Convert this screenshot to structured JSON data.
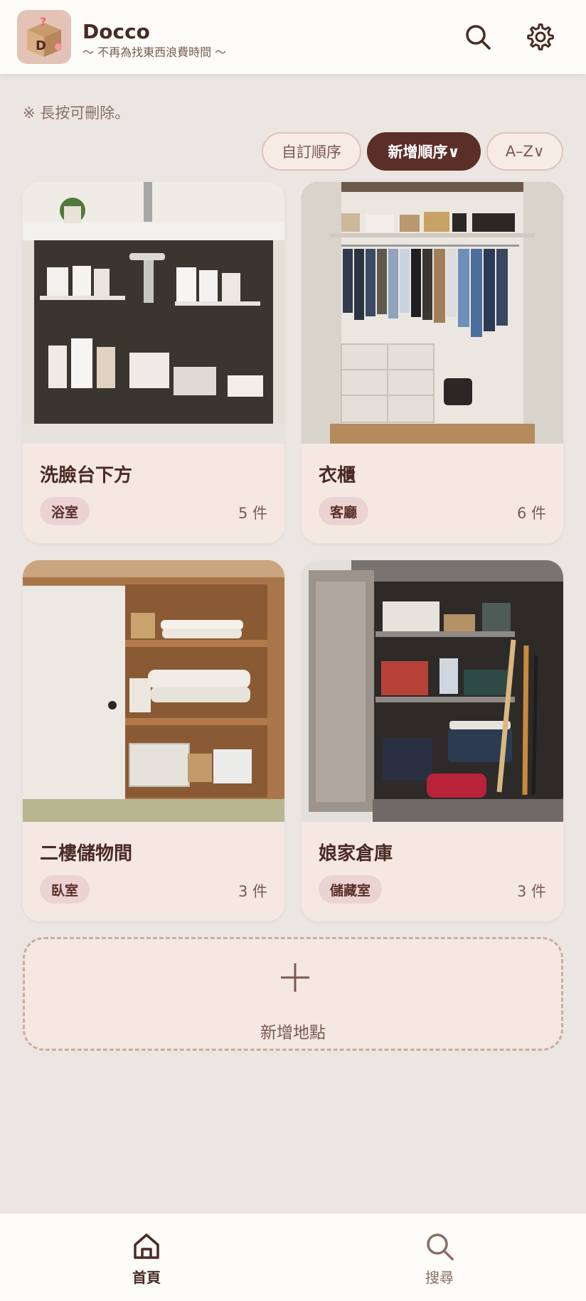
{
  "header": {
    "logo_letter": "D",
    "logo_mark": "?",
    "app_name": "Docco",
    "tagline": "～ 不再為找東西浪費時間 ～",
    "search_icon": "search-icon",
    "settings_icon": "gear-icon"
  },
  "hint": "※ 長按可刪除。",
  "sort": {
    "options": [
      {
        "label": "自訂順序",
        "active": false
      },
      {
        "label": "新增順序∨",
        "active": true
      },
      {
        "label": "A–Z∨",
        "active": false
      }
    ]
  },
  "locations": [
    {
      "name": "洗臉台下方",
      "room": "浴室",
      "count": "5 件",
      "photo": "under-sink cabinet with bottles and baskets"
    },
    {
      "name": "衣櫃",
      "room": "客廳",
      "count": "6 件",
      "photo": "wardrobe with hanging clothes"
    },
    {
      "name": "二樓儲物間",
      "room": "臥室",
      "count": "3 件",
      "photo": "closet with folded futons"
    },
    {
      "name": "娘家倉庫",
      "room": "儲藏室",
      "count": "3 件",
      "photo": "storage shed with boxes and tools"
    }
  ],
  "add_location": {
    "label": "新增地點"
  },
  "nav": {
    "items": [
      {
        "label": "首頁",
        "icon": "home-icon",
        "active": true
      },
      {
        "label": "搜尋",
        "icon": "search-icon",
        "active": false
      }
    ]
  },
  "colors": {
    "accent": "#5a2f27",
    "card_background": "#f5e8e2",
    "badge_background": "#ecd3d3",
    "page_background": "#ebe6e1"
  }
}
